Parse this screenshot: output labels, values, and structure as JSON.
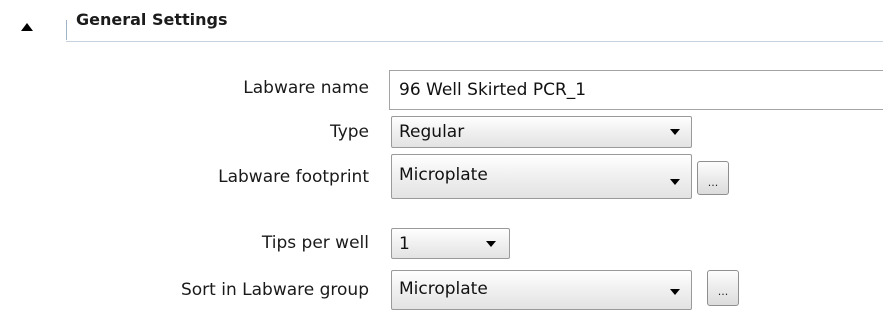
{
  "section": {
    "title": "General Settings"
  },
  "form": {
    "labware_name": {
      "label": "Labware name",
      "value": "96 Well Skirted PCR_1"
    },
    "type": {
      "label": "Type",
      "value": "Regular"
    },
    "labware_footprint": {
      "label": "Labware footprint",
      "value": "Microplate",
      "browse_label": "..."
    },
    "tips_per_well": {
      "label": "Tips per well",
      "value": "1"
    },
    "sort_in_labware_group": {
      "label": "Sort in Labware group",
      "value": "Microplate",
      "browse_label": "..."
    }
  }
}
